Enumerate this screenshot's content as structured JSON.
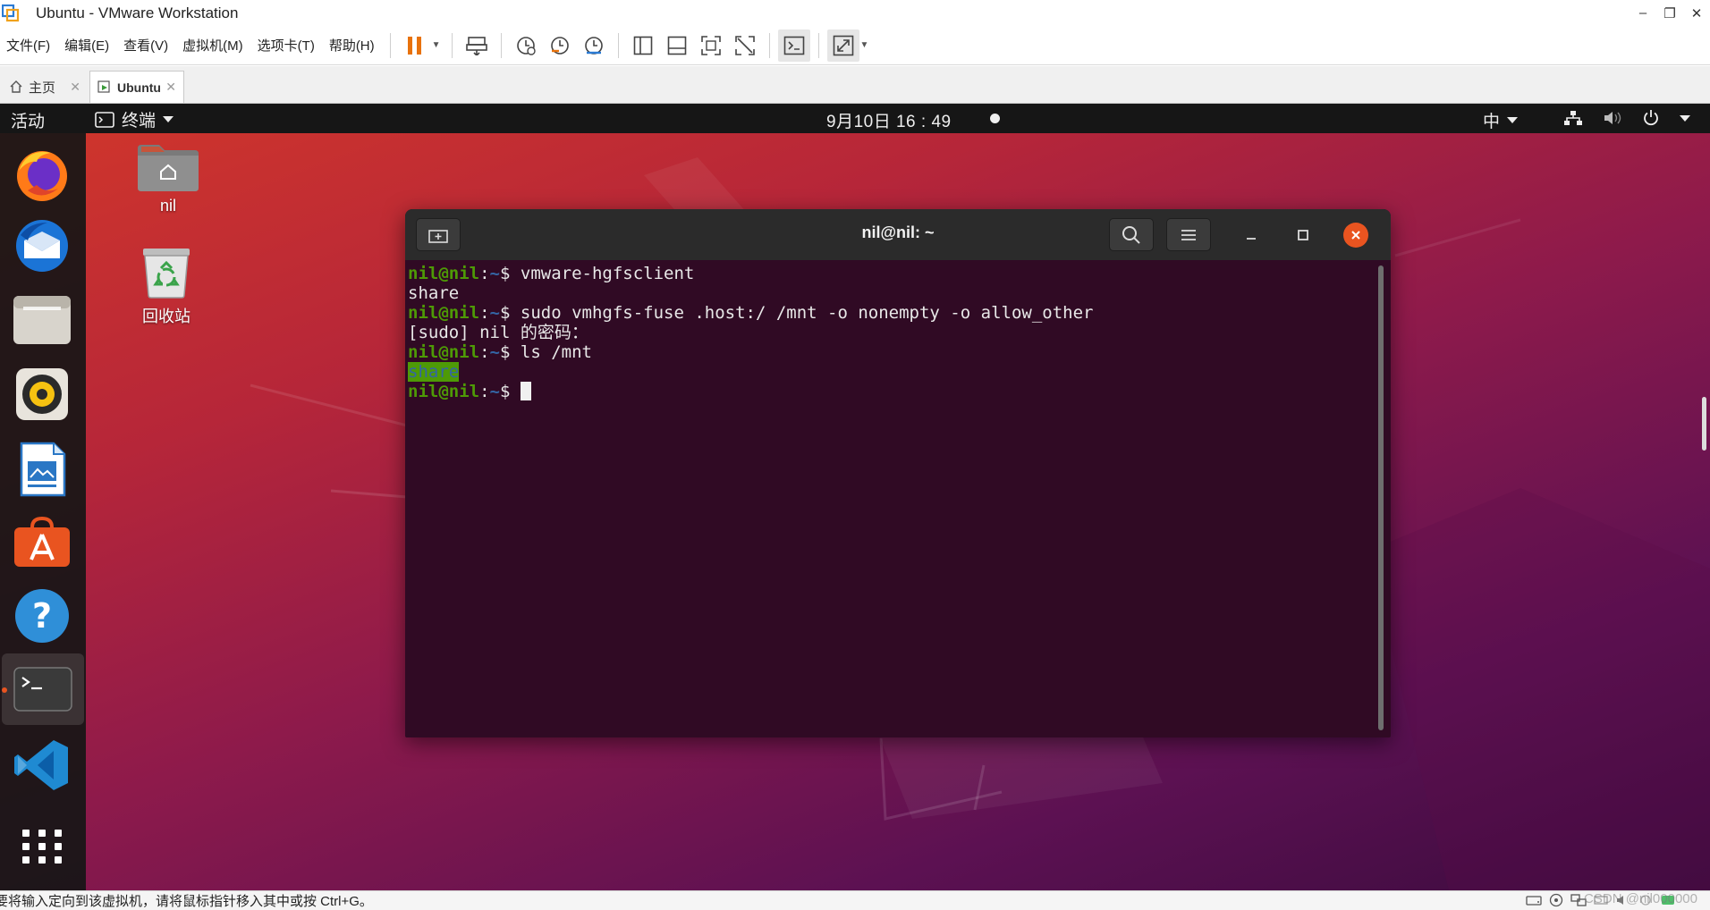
{
  "window": {
    "title": "Ubuntu - VMware Workstation",
    "controls": [
      "–",
      "❐",
      "✕"
    ]
  },
  "menubar": {
    "items": [
      "文件(F)",
      "编辑(E)",
      "查看(V)",
      "虚拟机(M)",
      "选项卡(T)",
      "帮助(H)"
    ]
  },
  "toolbar": {
    "icons": [
      "pause-icon",
      "send-ctrl-alt-del-icon",
      "snapshot-icon",
      "revert-snapshot-icon",
      "snapshot-manager-icon",
      "library-view-icon",
      "thumbnail-bar-icon",
      "fullscreen-icon",
      "unity-icon",
      "console-view-icon",
      "stretch-guest-icon"
    ]
  },
  "tabs": [
    {
      "label": "主页",
      "icon": "home-icon"
    },
    {
      "label": "Ubuntu",
      "icon": "vm-icon",
      "active": true
    }
  ],
  "ubuntu_topbar": {
    "activities": "活动",
    "app_menu": "终端",
    "clock": "9月10日 16 : 49",
    "input_method": "中"
  },
  "dock": {
    "items": [
      "firefox-icon",
      "thunderbird-icon",
      "files-icon",
      "rhythmbox-icon",
      "libreoffice-writer-icon",
      "ubuntu-software-icon",
      "help-icon",
      "terminal-icon",
      "vscode-icon"
    ],
    "show_apps": "show-applications-icon"
  },
  "desktop": {
    "icons": [
      {
        "label": "nil",
        "icon": "home-folder-icon"
      },
      {
        "label": "回收站",
        "icon": "trash-icon"
      }
    ]
  },
  "terminal": {
    "title": "nil@nil: ~",
    "prompt_user": "nil@nil",
    "prompt_path": "~",
    "lines": [
      {
        "type": "prompt",
        "cmd": "vmware-hgfsclient"
      },
      {
        "type": "output",
        "text": "share"
      },
      {
        "type": "prompt",
        "cmd": "sudo vmhgfs-fuse .host:/ /mnt -o nonempty -o allow_other"
      },
      {
        "type": "output",
        "text": "[sudo] nil 的密码："
      },
      {
        "type": "prompt",
        "cmd": "ls /mnt"
      },
      {
        "type": "dir",
        "text": "share"
      },
      {
        "type": "prompt",
        "cmd": "",
        "cursor": true
      }
    ]
  },
  "statusbar": {
    "text": "要将输入定向到该虚拟机，请将鼠标指针移入其中或按 Ctrl+G。",
    "watermark": "CSDN @nil000000"
  },
  "colors": {
    "ubuntu_orange": "#e95420",
    "terminal_bg": "#300a24",
    "prompt_green": "#4e9a06",
    "prompt_blue": "#3465a4"
  }
}
